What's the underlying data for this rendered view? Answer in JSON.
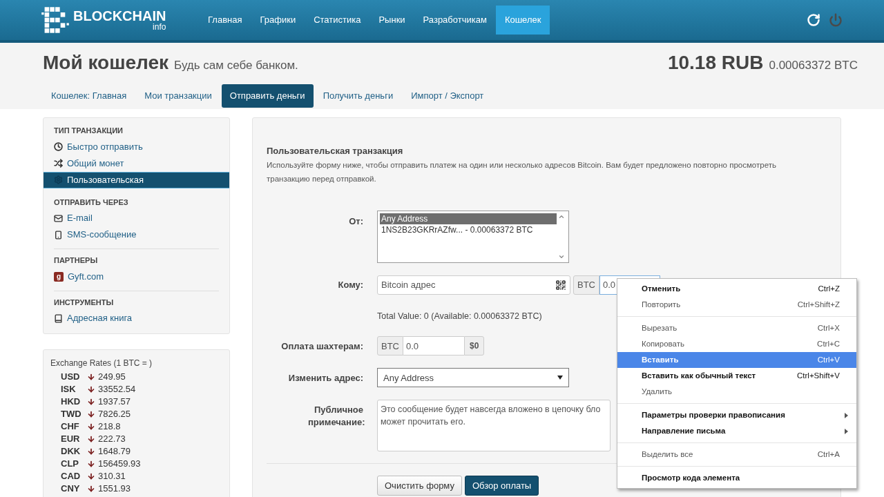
{
  "header": {
    "logo_text": "BLOCKCHAIN",
    "logo_sub": "info",
    "nav": [
      {
        "label": "Главная",
        "selected": false
      },
      {
        "label": "Графики",
        "selected": false
      },
      {
        "label": "Статистика",
        "selected": false
      },
      {
        "label": "Рынки",
        "selected": false
      },
      {
        "label": "Разработчикам",
        "selected": false
      },
      {
        "label": "Кошелек",
        "selected": true
      }
    ]
  },
  "title": {
    "heading": "Мой кошелек",
    "subtitle": "Будь сам себе банком.",
    "balance": "10.18 RUB",
    "balance_btc": "0.00063372 BTC"
  },
  "tabs": [
    {
      "label": "Кошелек: Главная",
      "selected": false
    },
    {
      "label": "Мои транзакции",
      "selected": false
    },
    {
      "label": "Отправить деньги",
      "selected": true
    },
    {
      "label": "Получить деньги",
      "selected": false
    },
    {
      "label": "Импорт / Экспорт",
      "selected": false
    }
  ],
  "sidebar": {
    "sections": [
      {
        "heading": "ТИП ТРАНЗАКЦИИ",
        "items": [
          {
            "label": "Быстро отправить",
            "selected": false
          },
          {
            "label": "Общий монет",
            "selected": false
          },
          {
            "label": "Пользовательская",
            "selected": true
          }
        ]
      },
      {
        "heading": "ОТПРАВИТЬ ЧЕРЕЗ",
        "items": [
          {
            "label": "E-mail",
            "selected": false
          },
          {
            "label": "SMS-сообщение",
            "selected": false
          }
        ]
      },
      {
        "heading": "ПАРТНЕРЫ",
        "items": [
          {
            "label": "Gyft.com",
            "badge": "g",
            "selected": false
          }
        ]
      },
      {
        "heading": "ИНСТРУМЕНТЫ",
        "items": [
          {
            "label": "Адресная книга",
            "selected": false
          }
        ]
      }
    ]
  },
  "exchange_rates": {
    "title": "Exchange Rates (1 BTC = )",
    "rates": [
      {
        "code": "USD",
        "value": "249.95"
      },
      {
        "code": "ISK",
        "value": "33552.54"
      },
      {
        "code": "HKD",
        "value": "1937.57"
      },
      {
        "code": "TWD",
        "value": "7826.25"
      },
      {
        "code": "CHF",
        "value": "218.8"
      },
      {
        "code": "EUR",
        "value": "222.73"
      },
      {
        "code": "DKK",
        "value": "1648.79"
      },
      {
        "code": "CLP",
        "value": "156459.93"
      },
      {
        "code": "CAD",
        "value": "310.31"
      },
      {
        "code": "CNY",
        "value": "1551.93"
      }
    ]
  },
  "form": {
    "title": "Пользовательская транзакция",
    "description": "Используйте форму ниже, чтобы отправить платеж на один или несколько адресов Bitcoin. Вам будет предложено повторно просмотреть транзакцию перед отправкой.",
    "from": {
      "label": "От:",
      "options": [
        {
          "label": "Any Address",
          "selected": true
        },
        {
          "label": "1NS2B23GKRrAZfw... - 0.00063372 BTC",
          "selected": false
        }
      ]
    },
    "to": {
      "label": "Кому:",
      "placeholder": "Bitcoin адрес",
      "currency": "BTC",
      "amount": "0.0"
    },
    "total": "Total Value: 0 (Available: 0.00063372 BTC)",
    "fee": {
      "label": "Оплата шахтерам:",
      "currency": "BTC",
      "value": "0.0",
      "usd": "$0"
    },
    "change": {
      "label": "Изменить адрес:",
      "value": "Any Address"
    },
    "note": {
      "label": "Публичное примечание:",
      "placeholder_lines": [
        "Это сообщение будет навсегда вложено в цепочку бло",
        "может прочитать его."
      ]
    },
    "buttons": [
      {
        "label": "Очистить форму",
        "kind": "secondary"
      },
      {
        "label": "Обзор оплаты",
        "kind": "primary"
      }
    ]
  },
  "context_menu": [
    {
      "kind": "item",
      "label": "Отменить",
      "shortcut": "Ctrl+Z",
      "disabled": false,
      "selected": false
    },
    {
      "kind": "item",
      "label": "Повторить",
      "shortcut": "Ctrl+Shift+Z",
      "disabled": true,
      "selected": false
    },
    {
      "kind": "separator"
    },
    {
      "kind": "item",
      "label": "Вырезать",
      "shortcut": "Ctrl+X",
      "disabled": true,
      "selected": false
    },
    {
      "kind": "item",
      "label": "Копировать",
      "shortcut": "Ctrl+C",
      "disabled": true,
      "selected": false
    },
    {
      "kind": "item",
      "label": "Вставить",
      "shortcut": "Ctrl+V",
      "disabled": false,
      "selected": true
    },
    {
      "kind": "item",
      "label": "Вставить как обычный текст",
      "shortcut": "Ctrl+Shift+V",
      "disabled": false,
      "selected": false
    },
    {
      "kind": "item",
      "label": "Удалить",
      "disabled": true,
      "selected": false
    },
    {
      "kind": "separator"
    },
    {
      "kind": "submenu",
      "label": "Параметры проверки правописания",
      "disabled": false,
      "selected": false
    },
    {
      "kind": "submenu",
      "label": "Направление письма",
      "disabled": false,
      "selected": false
    },
    {
      "kind": "separator"
    },
    {
      "kind": "item",
      "label": "Выделить все",
      "shortcut": "Ctrl+A",
      "disabled": true,
      "selected": false
    },
    {
      "kind": "separator"
    },
    {
      "kind": "item",
      "label": "Просмотр кода элемента",
      "disabled": false,
      "selected": false
    }
  ]
}
